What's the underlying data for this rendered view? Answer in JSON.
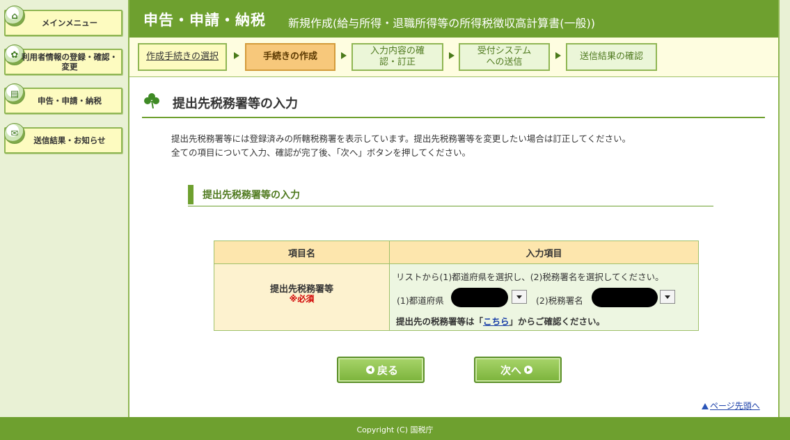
{
  "sidebar": {
    "items": [
      {
        "label": "メインメニュー",
        "icon": "home-icon"
      },
      {
        "label": "利用者情報の登録・確認・変更",
        "icon": "user-settings-icon"
      },
      {
        "label": "申告・申請・納税",
        "icon": "document-icon"
      },
      {
        "label": "送信結果・お知らせ",
        "icon": "mail-icon"
      }
    ]
  },
  "header": {
    "title": "申告・申請・納税",
    "subtitle": "新規作成(給与所得・退職所得等の所得税徴収高計算書(一般))"
  },
  "steps": [
    {
      "label": "作成手続きの選択",
      "state": "link"
    },
    {
      "label": "手続きの作成",
      "state": "current"
    },
    {
      "label": "入力内容の確認・訂正",
      "state": "pending"
    },
    {
      "label": "受付システムへの送信",
      "state": "pending"
    },
    {
      "label": "送信結果の確認",
      "state": "pending"
    }
  ],
  "page": {
    "title": "提出先税務署等の入力",
    "intro_lines": [
      "提出先税務署等には登録済みの所轄税務署を表示しています。提出先税務署等を変更したい場合は訂正してください。",
      "全ての項目について入力、確認が完了後、「次へ」ボタンを押してください。"
    ],
    "section_title": "提出先税務署等の入力"
  },
  "table": {
    "headers": {
      "name": "項目名",
      "input": "入力項目"
    },
    "row": {
      "label": "提出先税務署等",
      "required": "※必須",
      "instruction": "リストから(1)都道府県を選択し、(2)税務署名を選択してください。",
      "prefecture_label": "(1)都道府県",
      "tax_office_label": "(2)税務署名",
      "confirm_before": "提出先の税務署等は「",
      "confirm_link": "こちら",
      "confirm_after": "」からご確認ください。"
    }
  },
  "buttons": {
    "back": "戻る",
    "next": "次へ"
  },
  "page_top_link": "ページ先頭へ",
  "footer": {
    "copyright": "Copyright (C) 国税庁"
  },
  "colors": {
    "header_green": "#6ea02f",
    "current_step": "#f7c87b",
    "required_red": "#d00000"
  }
}
